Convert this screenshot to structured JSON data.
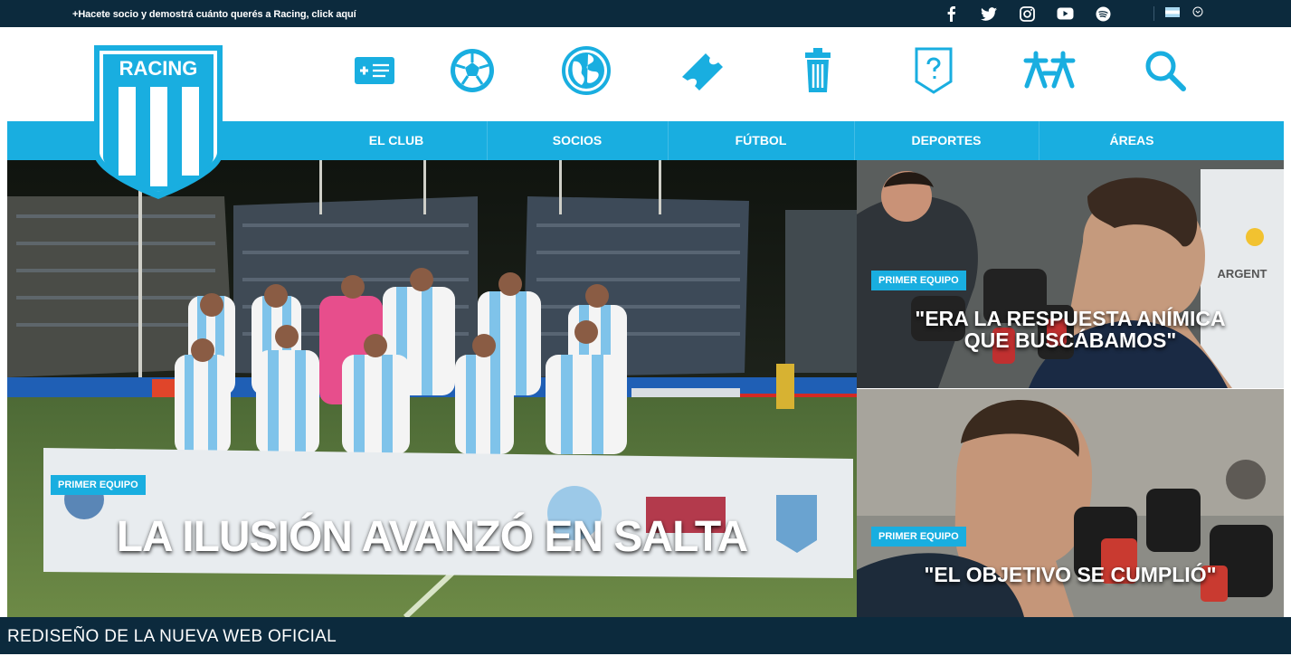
{
  "topbar": {
    "promo": "+Hacete socio y demostrá cuánto querés a Racing, click aquí",
    "social": [
      "facebook-icon",
      "twitter-icon",
      "instagram-icon",
      "youtube-icon",
      "spotify-icon"
    ]
  },
  "logo": {
    "text": "RACING"
  },
  "icons": [
    "membership-card-icon",
    "soccer-ball-icon",
    "globe-icon",
    "ticket-icon",
    "trash-bin-icon",
    "help-icon",
    "community-icon",
    "search-icon"
  ],
  "nav": {
    "items": [
      {
        "label": "EL CLUB"
      },
      {
        "label": "SOCIOS"
      },
      {
        "label": "FÚTBOL"
      },
      {
        "label": "DEPORTES"
      },
      {
        "label": "ÁREAS"
      }
    ]
  },
  "news": {
    "main": {
      "category": "PRIMER EQUIPO",
      "title": "LA ILUSIÓN AVANZÓ EN SALTA"
    },
    "side": [
      {
        "category": "PRIMER EQUIPO",
        "title_line1": "\"ERA LA RESPUESTA ANÍMICA",
        "title_line2": "QUE BUSCÁBAMOS\""
      },
      {
        "category": "PRIMER EQUIPO",
        "title_line1": "\"EL OBJETIVO SE CUMPLIÓ\""
      }
    ]
  },
  "footer": {
    "caption": "REDISEÑO DE LA NUEVA WEB OFICIAL"
  },
  "colors": {
    "primary": "#19aee0",
    "dark": "#0c2a3d",
    "white": "#ffffff"
  }
}
